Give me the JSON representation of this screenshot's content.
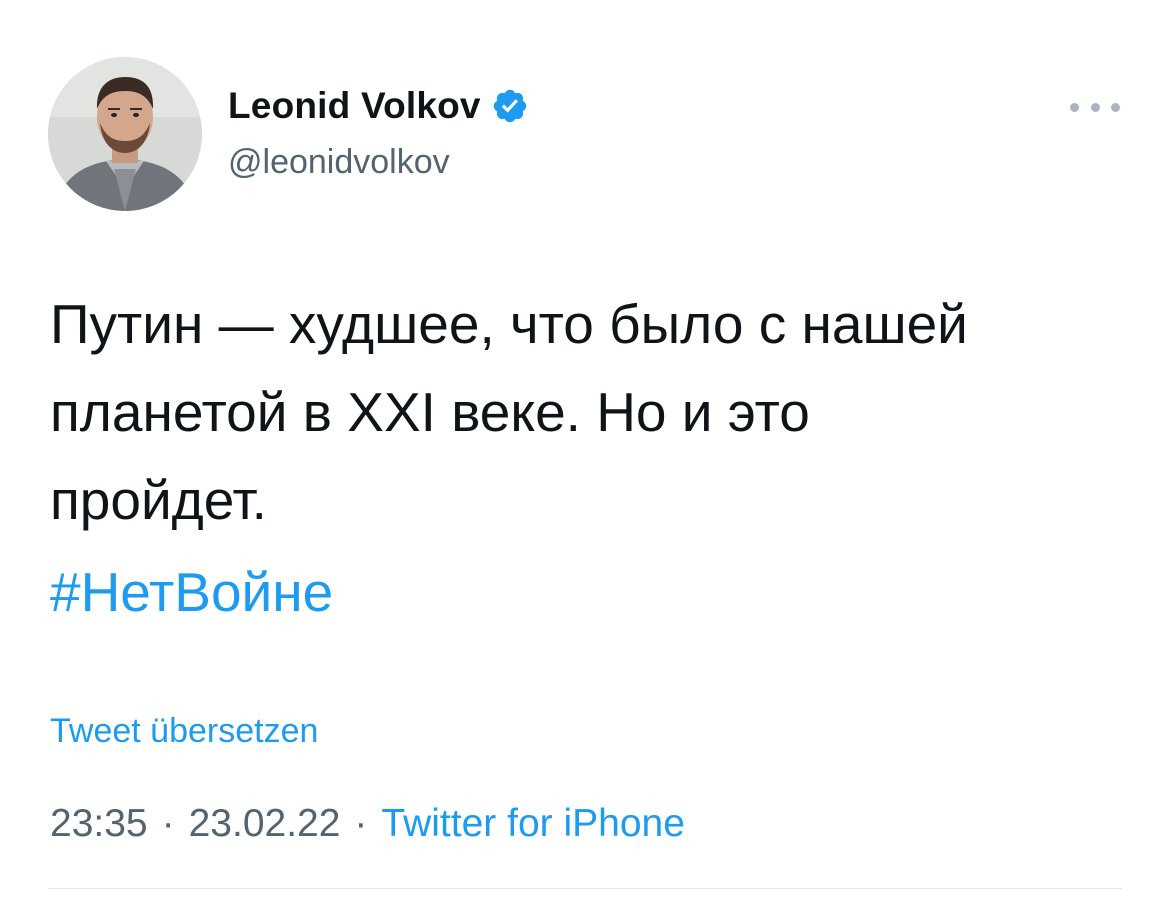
{
  "tweet": {
    "author": {
      "display_name": "Leonid Volkov",
      "handle": "@leonidvolkov",
      "verified": true,
      "verified_icon": "verified-badge-icon",
      "avatar_icon": "avatar-photo"
    },
    "more_icon": "more-horizontal-icon",
    "text": "Путин — худшее, что было с нашей\nпланетой в XXI веке. Но и это\nпройдет.",
    "hashtag": "#НетВойне",
    "translate_label": "Tweet übersetzen",
    "time": "23:35",
    "date": "23.02.22",
    "separator": "·",
    "source": "Twitter for iPhone"
  },
  "colors": {
    "link": "#1d9bf0",
    "text": "#0f1419",
    "secondary": "#536471",
    "verified": "#1d9bf0",
    "divider": "#e1e8ed"
  }
}
